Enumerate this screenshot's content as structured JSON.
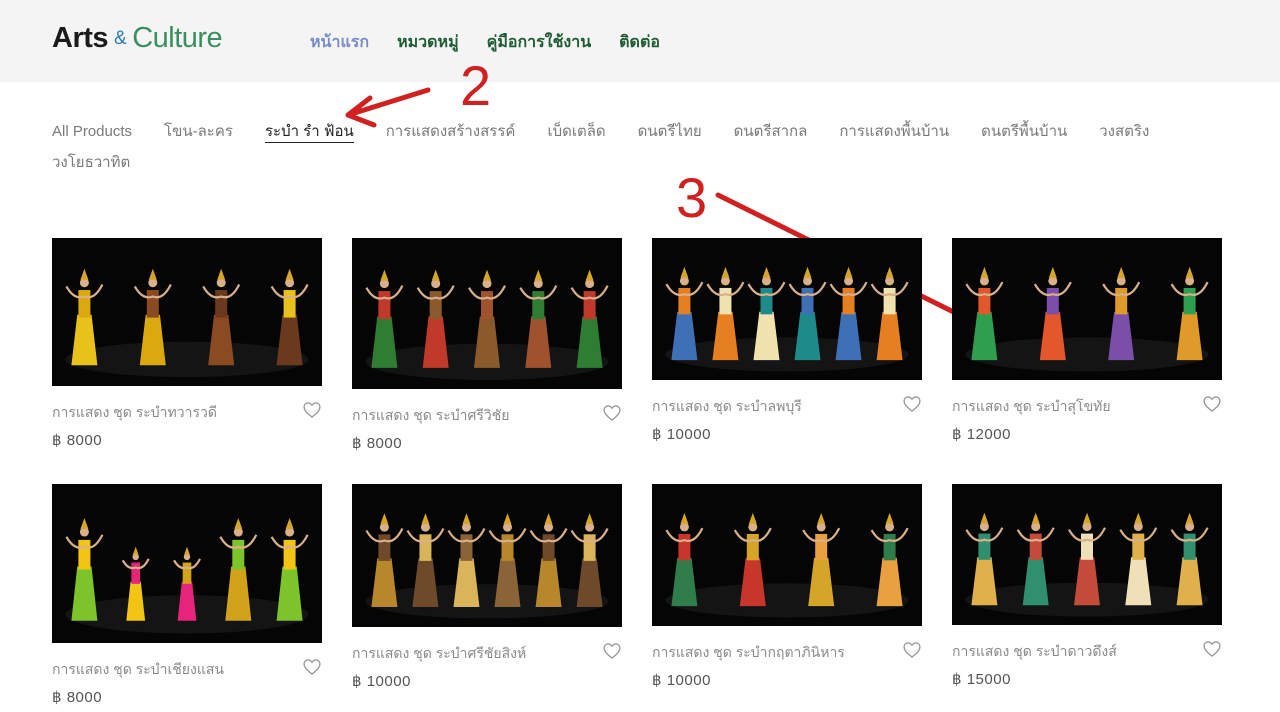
{
  "header": {
    "logo": {
      "part1": "Arts",
      "amp": "&",
      "part2": "Culture"
    },
    "nav": [
      {
        "label": "หน้าแรก",
        "active": true
      },
      {
        "label": "หมวดหมู่",
        "active": false
      },
      {
        "label": "คู่มือการใช้งาน",
        "active": false
      },
      {
        "label": "ติดต่อ",
        "active": false
      }
    ]
  },
  "categories": [
    {
      "label": "All Products",
      "active": false
    },
    {
      "label": "โขน-ละคร",
      "active": false
    },
    {
      "label": "ระบำ รำ ฟ้อน",
      "active": true
    },
    {
      "label": "การแสดงสร้างสรรค์",
      "active": false
    },
    {
      "label": "เบ็ดเตล็ด",
      "active": false
    },
    {
      "label": "ดนตรีไทย",
      "active": false
    },
    {
      "label": "ดนตรีสากล",
      "active": false
    },
    {
      "label": "การแสดงพื้นบ้าน",
      "active": false
    },
    {
      "label": "ดนตรีพื้นบ้าน",
      "active": false
    },
    {
      "label": "วงสตริง",
      "active": false
    },
    {
      "label": "วงโยธวาทิต",
      "active": false
    }
  ],
  "annotations": [
    {
      "label": "2"
    },
    {
      "label": "3"
    }
  ],
  "products": [
    {
      "title": "การแสดง ชุด ระบำทวารวดี",
      "price": "฿ 8000",
      "palette": [
        "#e8c21a",
        "#d9a90f",
        "#8a4a22",
        "#6b3a1e"
      ]
    },
    {
      "title": "การแสดง ชุด ระบำศรีวิชัย",
      "price": "฿ 8000",
      "palette": [
        "#2e7d32",
        "#c0392b",
        "#8b5a2b",
        "#a0522d"
      ]
    },
    {
      "title": "การแสดง ชุด ระบำลพบุรี",
      "price": "฿ 10000",
      "palette": [
        "#3f6fb5",
        "#e67e22",
        "#f1e3b0",
        "#1f8a8a"
      ]
    },
    {
      "title": "การแสดง ชุด ระบำสุโขทัย",
      "price": "฿ 12000",
      "palette": [
        "#2e9e4f",
        "#e2572b",
        "#7b4fa8",
        "#e09a2a"
      ]
    },
    {
      "title": "การแสดง ชุด ระบำเชียงแสน",
      "price": "฿ 8000",
      "palette": [
        "#7cc42a",
        "#f2c515",
        "#e6257a",
        "#d1a31a"
      ]
    },
    {
      "title": "การแสดง ชุด ระบำศรีชัยสิงห์",
      "price": "฿ 10000",
      "palette": [
        "#b8862b",
        "#6e4a2a",
        "#d9b45a",
        "#8a6436"
      ]
    },
    {
      "title": "การแสดง ชุด ระบำกฤตาภินิหาร",
      "price": "฿ 10000",
      "palette": [
        "#2f7d4a",
        "#c7352b",
        "#d4a528",
        "#e8a041"
      ]
    },
    {
      "title": "การแสดง ชุด ระบำดาวดึงส์",
      "price": "฿ 15000",
      "palette": [
        "#e0b04a",
        "#2f8f6f",
        "#c44a3a",
        "#f0e0b8"
      ]
    }
  ]
}
